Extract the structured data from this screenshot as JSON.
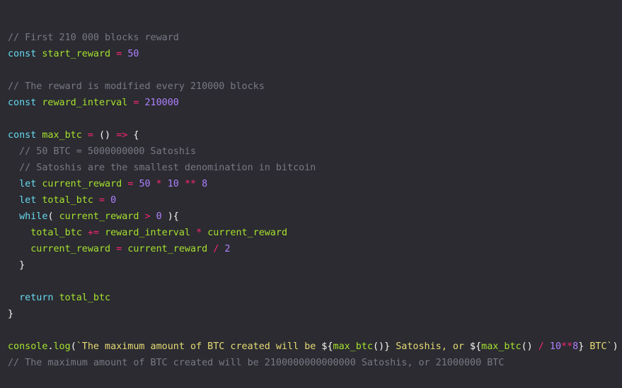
{
  "colors": {
    "background": "#2b2b31",
    "comment": "#797985",
    "keyword": "#66d9ef",
    "identifier": "#a6e22e",
    "operator": "#f92672",
    "number": "#ae81ff",
    "punctuation": "#f8f8f2",
    "string": "#e6db74"
  },
  "code": {
    "lines": [
      [
        {
          "t": "comment",
          "v": "// First 210 000 blocks reward"
        }
      ],
      [
        {
          "t": "keyword",
          "v": "const"
        },
        {
          "t": "plain",
          "v": " "
        },
        {
          "t": "ident",
          "v": "start_reward"
        },
        {
          "t": "plain",
          "v": " "
        },
        {
          "t": "op",
          "v": "="
        },
        {
          "t": "plain",
          "v": " "
        },
        {
          "t": "number",
          "v": "50"
        }
      ],
      [],
      [
        {
          "t": "comment",
          "v": "// The reward is modified every 210000 blocks"
        }
      ],
      [
        {
          "t": "keyword",
          "v": "const"
        },
        {
          "t": "plain",
          "v": " "
        },
        {
          "t": "ident",
          "v": "reward_interval"
        },
        {
          "t": "plain",
          "v": " "
        },
        {
          "t": "op",
          "v": "="
        },
        {
          "t": "plain",
          "v": " "
        },
        {
          "t": "number",
          "v": "210000"
        }
      ],
      [],
      [
        {
          "t": "keyword",
          "v": "const"
        },
        {
          "t": "plain",
          "v": " "
        },
        {
          "t": "ident",
          "v": "max_btc"
        },
        {
          "t": "plain",
          "v": " "
        },
        {
          "t": "op",
          "v": "="
        },
        {
          "t": "plain",
          "v": " "
        },
        {
          "t": "punct",
          "v": "()"
        },
        {
          "t": "plain",
          "v": " "
        },
        {
          "t": "op",
          "v": "=>"
        },
        {
          "t": "plain",
          "v": " "
        },
        {
          "t": "punct",
          "v": "{"
        }
      ],
      [
        {
          "t": "plain",
          "v": "  "
        },
        {
          "t": "comment",
          "v": "// 50 BTC = 5000000000 Satoshis"
        }
      ],
      [
        {
          "t": "plain",
          "v": "  "
        },
        {
          "t": "comment",
          "v": "// Satoshis are the smallest denomination in bitcoin"
        }
      ],
      [
        {
          "t": "plain",
          "v": "  "
        },
        {
          "t": "keyword",
          "v": "let"
        },
        {
          "t": "plain",
          "v": " "
        },
        {
          "t": "ident",
          "v": "current_reward"
        },
        {
          "t": "plain",
          "v": " "
        },
        {
          "t": "op",
          "v": "="
        },
        {
          "t": "plain",
          "v": " "
        },
        {
          "t": "number",
          "v": "50"
        },
        {
          "t": "plain",
          "v": " "
        },
        {
          "t": "op",
          "v": "*"
        },
        {
          "t": "plain",
          "v": " "
        },
        {
          "t": "number",
          "v": "10"
        },
        {
          "t": "plain",
          "v": " "
        },
        {
          "t": "op",
          "v": "**"
        },
        {
          "t": "plain",
          "v": " "
        },
        {
          "t": "number",
          "v": "8"
        }
      ],
      [
        {
          "t": "plain",
          "v": "  "
        },
        {
          "t": "keyword",
          "v": "let"
        },
        {
          "t": "plain",
          "v": " "
        },
        {
          "t": "ident",
          "v": "total_btc"
        },
        {
          "t": "plain",
          "v": " "
        },
        {
          "t": "op",
          "v": "="
        },
        {
          "t": "plain",
          "v": " "
        },
        {
          "t": "number",
          "v": "0"
        }
      ],
      [
        {
          "t": "plain",
          "v": "  "
        },
        {
          "t": "keyword",
          "v": "while"
        },
        {
          "t": "punct",
          "v": "("
        },
        {
          "t": "plain",
          "v": " "
        },
        {
          "t": "ident",
          "v": "current_reward"
        },
        {
          "t": "plain",
          "v": " "
        },
        {
          "t": "op",
          "v": ">"
        },
        {
          "t": "plain",
          "v": " "
        },
        {
          "t": "number",
          "v": "0"
        },
        {
          "t": "plain",
          "v": " "
        },
        {
          "t": "punct",
          "v": "){"
        }
      ],
      [
        {
          "t": "plain",
          "v": "    "
        },
        {
          "t": "ident",
          "v": "total_btc"
        },
        {
          "t": "plain",
          "v": " "
        },
        {
          "t": "op",
          "v": "+="
        },
        {
          "t": "plain",
          "v": " "
        },
        {
          "t": "ident",
          "v": "reward_interval"
        },
        {
          "t": "plain",
          "v": " "
        },
        {
          "t": "op",
          "v": "*"
        },
        {
          "t": "plain",
          "v": " "
        },
        {
          "t": "ident",
          "v": "current_reward"
        }
      ],
      [
        {
          "t": "plain",
          "v": "    "
        },
        {
          "t": "ident",
          "v": "current_reward"
        },
        {
          "t": "plain",
          "v": " "
        },
        {
          "t": "op",
          "v": "="
        },
        {
          "t": "plain",
          "v": " "
        },
        {
          "t": "ident",
          "v": "current_reward"
        },
        {
          "t": "plain",
          "v": " "
        },
        {
          "t": "op",
          "v": "/"
        },
        {
          "t": "plain",
          "v": " "
        },
        {
          "t": "number",
          "v": "2"
        }
      ],
      [
        {
          "t": "plain",
          "v": "  "
        },
        {
          "t": "punct",
          "v": "}"
        }
      ],
      [],
      [
        {
          "t": "plain",
          "v": "  "
        },
        {
          "t": "keyword",
          "v": "return"
        },
        {
          "t": "plain",
          "v": " "
        },
        {
          "t": "ident",
          "v": "total_btc"
        }
      ],
      [
        {
          "t": "punct",
          "v": "}"
        }
      ],
      [],
      [
        {
          "t": "ident",
          "v": "console"
        },
        {
          "t": "punct",
          "v": "."
        },
        {
          "t": "ident",
          "v": "log"
        },
        {
          "t": "punct",
          "v": "("
        },
        {
          "t": "string",
          "v": "`The maximum amount of BTC created will be "
        },
        {
          "t": "punct",
          "v": "${"
        },
        {
          "t": "ident",
          "v": "max_btc"
        },
        {
          "t": "punct",
          "v": "()}"
        },
        {
          "t": "string",
          "v": " Satoshis, or "
        },
        {
          "t": "punct",
          "v": "${"
        },
        {
          "t": "ident",
          "v": "max_btc"
        },
        {
          "t": "punct",
          "v": "()"
        },
        {
          "t": "plain",
          "v": " "
        },
        {
          "t": "op",
          "v": "/"
        },
        {
          "t": "plain",
          "v": " "
        },
        {
          "t": "number",
          "v": "10"
        },
        {
          "t": "op",
          "v": "**"
        },
        {
          "t": "number",
          "v": "8"
        },
        {
          "t": "punct",
          "v": "}"
        },
        {
          "t": "string",
          "v": " BTC`"
        },
        {
          "t": "punct",
          "v": ")"
        }
      ],
      [
        {
          "t": "comment",
          "v": "// The maximum amount of BTC created will be 2100000000000000 Satoshis, or 21000000 BTC"
        }
      ]
    ]
  }
}
